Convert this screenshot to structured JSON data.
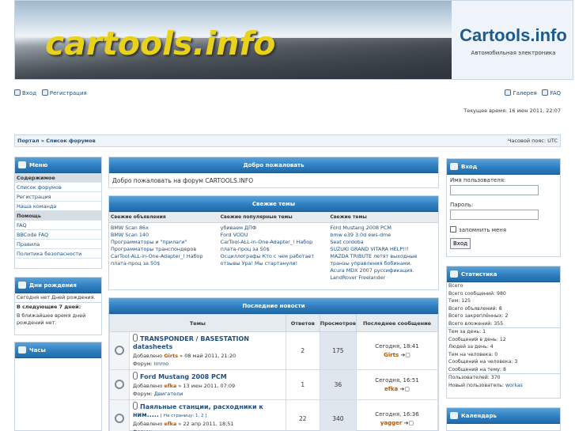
{
  "header": {
    "logo_text": "cartools.info",
    "site_title": "Cartools.info",
    "site_subtitle": "Автомобильная электроника"
  },
  "toplinks": {
    "login": "Вход",
    "register": "Регистрация",
    "gallery": "Галерея",
    "faq": "FAQ"
  },
  "current_time": "Текущее время: 16 июн 2011, 22:07",
  "navbar": {
    "breadcrumb": "Портал » Список форумов",
    "timezone": "Часовой пояс: UTC"
  },
  "menu": {
    "title": "Меню",
    "items": [
      {
        "label": "Содержимое",
        "section": true
      },
      {
        "label": "Список форумов",
        "section": false
      },
      {
        "label": "Регистрация",
        "section": false
      },
      {
        "label": "Наша команда",
        "section": false
      },
      {
        "label": "Помощь",
        "section": true
      },
      {
        "label": "FAQ",
        "section": false
      },
      {
        "label": "BBCode FAQ",
        "section": false
      },
      {
        "label": "Правила",
        "section": false
      },
      {
        "label": "Политика безопасности",
        "section": false
      }
    ]
  },
  "birthdays": {
    "title": "Дни рождения",
    "today": "Сегодня нет Дней рождения.",
    "next_label": "В следующие 7 дней:",
    "next_text": "В ближайшее время дней рождений нет."
  },
  "clock": {
    "title": "Часы"
  },
  "welcome": {
    "title": "Добро пожаловать",
    "text": "Добро пожаловать на форум CARTOOLS.INFO"
  },
  "fresh_topics": {
    "title": "Свежие темы",
    "columns": [
      {
        "header": "Свежие объявления",
        "items": [
          "BMW Scan 86x",
          "BMW Scan 140",
          "Программаторы и \"прилаги\"",
          "Программаторы транспондеров",
          "CarTool-ALL-in-One-Adapter_! Набор плата-проц за 50$"
        ]
      },
      {
        "header": "Свежие популярные темы",
        "items": [
          "убиваем ДПФ",
          "Ford VODU",
          "CarTool-ALL-in-One-Adapter_! Набор плата-проц за 50$",
          "Осциллографы Кто с чем работает отзывы Ура! Мы стартанули!"
        ]
      },
      {
        "header": "Свежие темы",
        "items": [
          "Ford Mustang 2008 PCM",
          "bmw e39 3.0d ews-dme",
          "Seat cordoba",
          "SUZUKI GRAND VITARA HELP!!!",
          "MAZDA TRIBUTE летят выходные транзы управления бобинами.",
          "Acura MDX 2007 руссификация.",
          "LandRover Freelander"
        ]
      }
    ]
  },
  "news": {
    "title": "Последние новости",
    "headers": {
      "topics": "Темы",
      "replies": "Ответов",
      "views": "Просмотров",
      "last": "Последнее сообщение"
    },
    "rows": [
      {
        "title": "TRANSPONDER / BASESTATION datasheets",
        "added_prefix": "Добавлено",
        "author": "Girts",
        "date": "» 08 май 2011, 21:20",
        "forum_prefix": "Форум:",
        "forum": "Immo",
        "pages": "",
        "replies": "2",
        "views": "175",
        "last_time": "Сегодня, 18:41",
        "last_user": "Girts"
      },
      {
        "title": "Ford Mustang 2008 PCM",
        "added_prefix": "Добавлено",
        "author": "efka",
        "date": "» 13 июн 2011, 07:09",
        "forum_prefix": "Форум:",
        "forum": "Двигатели",
        "pages": "",
        "replies": "1",
        "views": "36",
        "last_time": "Сегодня, 16:51",
        "last_user": "efka"
      },
      {
        "title": "Паяльные станции, расходники к ним.....",
        "added_prefix": "Добавлено",
        "author": "efka",
        "date": "» 22 апр 2011, 18:51",
        "forum_prefix": "Форум:",
        "forum": "",
        "pages": "[ На страницу: 1, 2 ]",
        "replies": "22",
        "views": "340",
        "last_time": "Сегодня, 16:36",
        "last_user": "yagger"
      }
    ]
  },
  "login": {
    "title": "Вход",
    "username_label": "Имя пользователя:",
    "password_label": "Пароль:",
    "remember_label": "запомнить меня",
    "submit_label": "Вход"
  },
  "stats": {
    "title": "Статистика",
    "lines_a": [
      "Всего",
      "Всего сообщений: 980",
      "Тем: 125",
      "Всего объявлений: 8",
      "Всего закреплённых: 2",
      "Всего вложений: 355"
    ],
    "lines_b": [
      "Тем за день: 1",
      "Сообщений в день: 12",
      "Людей за день: 4",
      "Тем на человека: 0",
      "Сообщений на человека: 3",
      "Сообщений на тему: 8"
    ],
    "users_label": "Пользователей: 370",
    "newest_prefix": "Новый пользователь:",
    "newest_user": "workas"
  },
  "calendar": {
    "title": "Календарь"
  },
  "colors": {
    "accent": "#2f7fc1",
    "link": "#1f4f80",
    "author": "#b05800",
    "logo": "#e8d21c"
  }
}
